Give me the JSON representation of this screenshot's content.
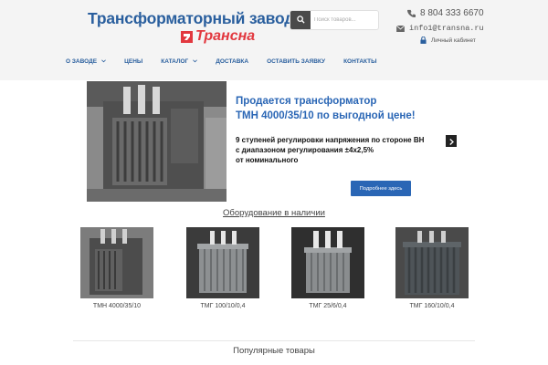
{
  "logo": {
    "title": "Трансформаторный завод",
    "subtitle": "Трансна"
  },
  "search": {
    "placeholder": "Поиск товаров..."
  },
  "contacts": {
    "phone": "8 804 333 6670",
    "email": "info1@transna.ru",
    "cabinet": "Личный кабинет"
  },
  "nav": {
    "items": [
      {
        "label": "О ЗАВОДЕ",
        "has_dropdown": true
      },
      {
        "label": "ЦЕНЫ",
        "has_dropdown": false
      },
      {
        "label": "КАТАЛОГ",
        "has_dropdown": true
      },
      {
        "label": "ДОСТАВКА",
        "has_dropdown": false
      },
      {
        "label": "ОСТАВИТЬ ЗАЯВКУ",
        "has_dropdown": false
      },
      {
        "label": "КОНТАКТЫ",
        "has_dropdown": false
      }
    ]
  },
  "banner": {
    "title_line1": "Продается трансформатор",
    "title_line2": "ТМН 4000/35/10 по выгодной цене!",
    "text_line1": "9 ступеней регулировки напряжения по стороне ВН",
    "text_line2": "с диапазоном регулирования ±4х2,5%",
    "text_line3": "от номинального",
    "button_label": "Подробнее здесь"
  },
  "equipment": {
    "title": "Оборудование в наличии",
    "products": [
      {
        "label": "ТМН 4000/35/10"
      },
      {
        "label": "ТМГ 100/10/0,4"
      },
      {
        "label": "ТМГ 25/6/0,4"
      },
      {
        "label": "ТМГ 160/10/0,4"
      }
    ]
  },
  "popular": {
    "title": "Популярные товары"
  },
  "colors": {
    "brand_blue": "#2a5f9e",
    "brand_red": "#e2383f",
    "button_blue": "#2a66b5"
  }
}
